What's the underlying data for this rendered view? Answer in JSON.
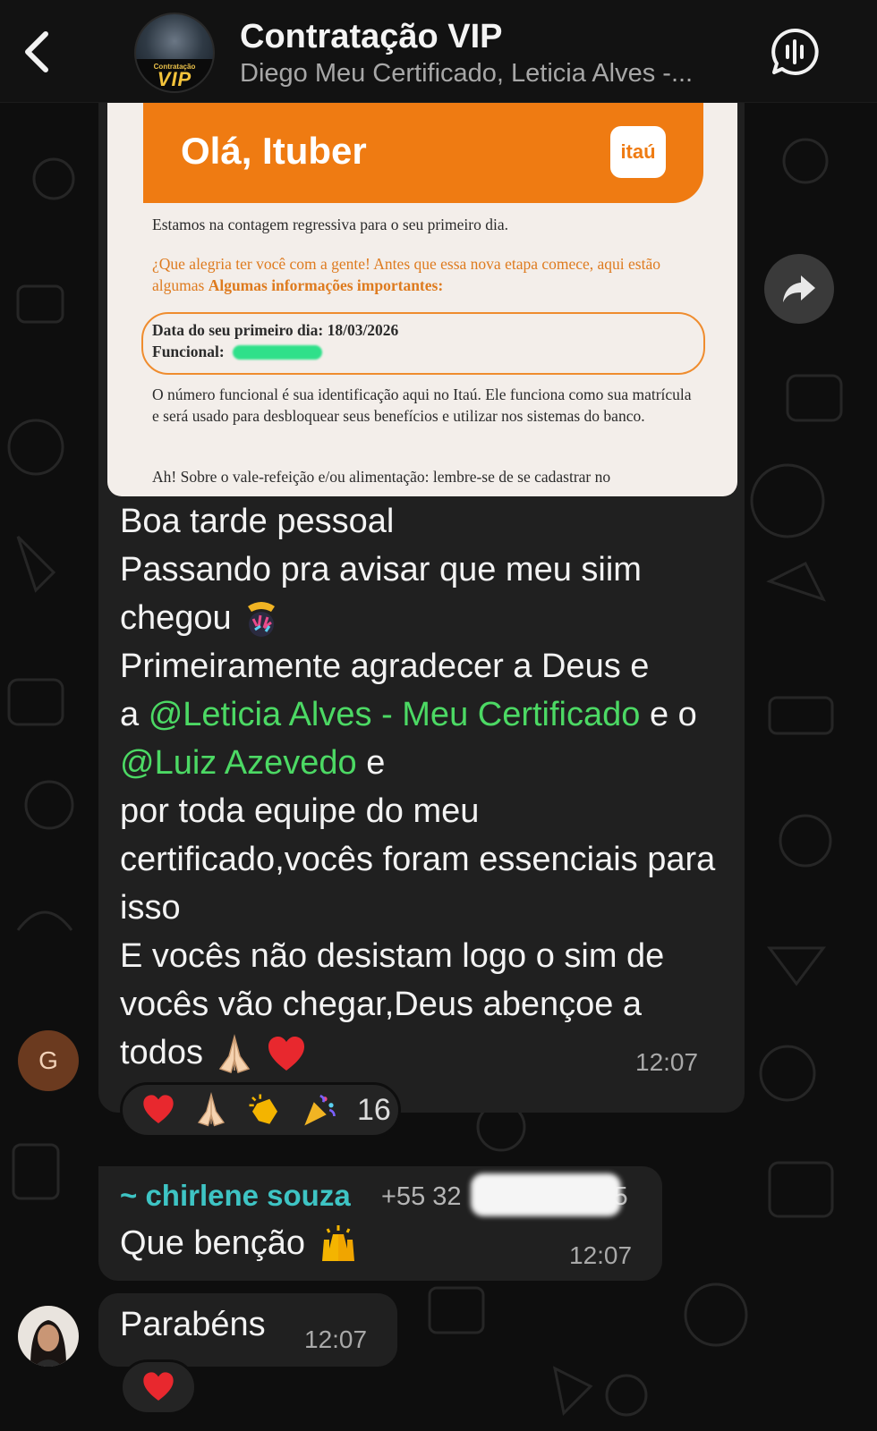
{
  "header": {
    "title": "Contratação VIP",
    "subtitle": "Diego Meu Certificado, Leticia Alves -...",
    "avatar_small_text": "Contratação",
    "avatar_text": "VIP"
  },
  "message1": {
    "attachment": {
      "greeting": "Olá, Ituber",
      "logo": "itaú",
      "p1": "Estamos na contagem regressiva para o seu primeiro dia.",
      "p2a": "¿Que alegria ter você com a gente! Antes que essa nova etapa comece, aqui estão algumas ",
      "p2b": "Algumas informações importantes:",
      "box_line1": "Data do seu primeiro dia: 18/03/2026",
      "box_line2": "Funcional:",
      "p3": "O número funcional é sua identificação aqui no Itaú. Ele funciona como sua matrícula e será usado para desbloquear seus benefícios e utilizar nos sistemas do banco.",
      "p4": "Ah! Sobre o vale-refeição e/ou alimentação: lembre-se de se cadastrar no"
    },
    "line1": "Boa tarde pessoal",
    "line2": "Passando pra avisar que meu siim",
    "line3": "chegou",
    "line4": "Primeiramente agradecer a Deus e",
    "line5_prefix": "a ",
    "mention1_at": "@",
    "mention1": "Leticia Alves - Meu Certificado",
    "between": " e o ",
    "mention2_at": "@",
    "mention2": "Luiz Azevedo",
    "line6_suffix": " e",
    "line7": "por toda equipe do meu certificado,vocês foram essenciais para isso",
    "line8": "E vocês não desistam logo o sim de vocês vão chegar,Deus abençoe a todos",
    "time": "12:07",
    "sender_initial": "G",
    "reactions": [
      "heart",
      "pray",
      "clap",
      "party"
    ],
    "reaction_count": "16"
  },
  "message2": {
    "sender": "~ chirlene souza",
    "phone_visible": "+55 32",
    "phone_tail": "5",
    "text": "Que benção",
    "time": "12:07"
  },
  "message3": {
    "text": "Parabéns",
    "time": "12:07",
    "reactions": [
      "heart"
    ]
  },
  "colors": {
    "mention": "#4cd964",
    "sender_name": "#3ec4c4",
    "itau_orange": "#ef7b12",
    "bubble": "#202020"
  }
}
